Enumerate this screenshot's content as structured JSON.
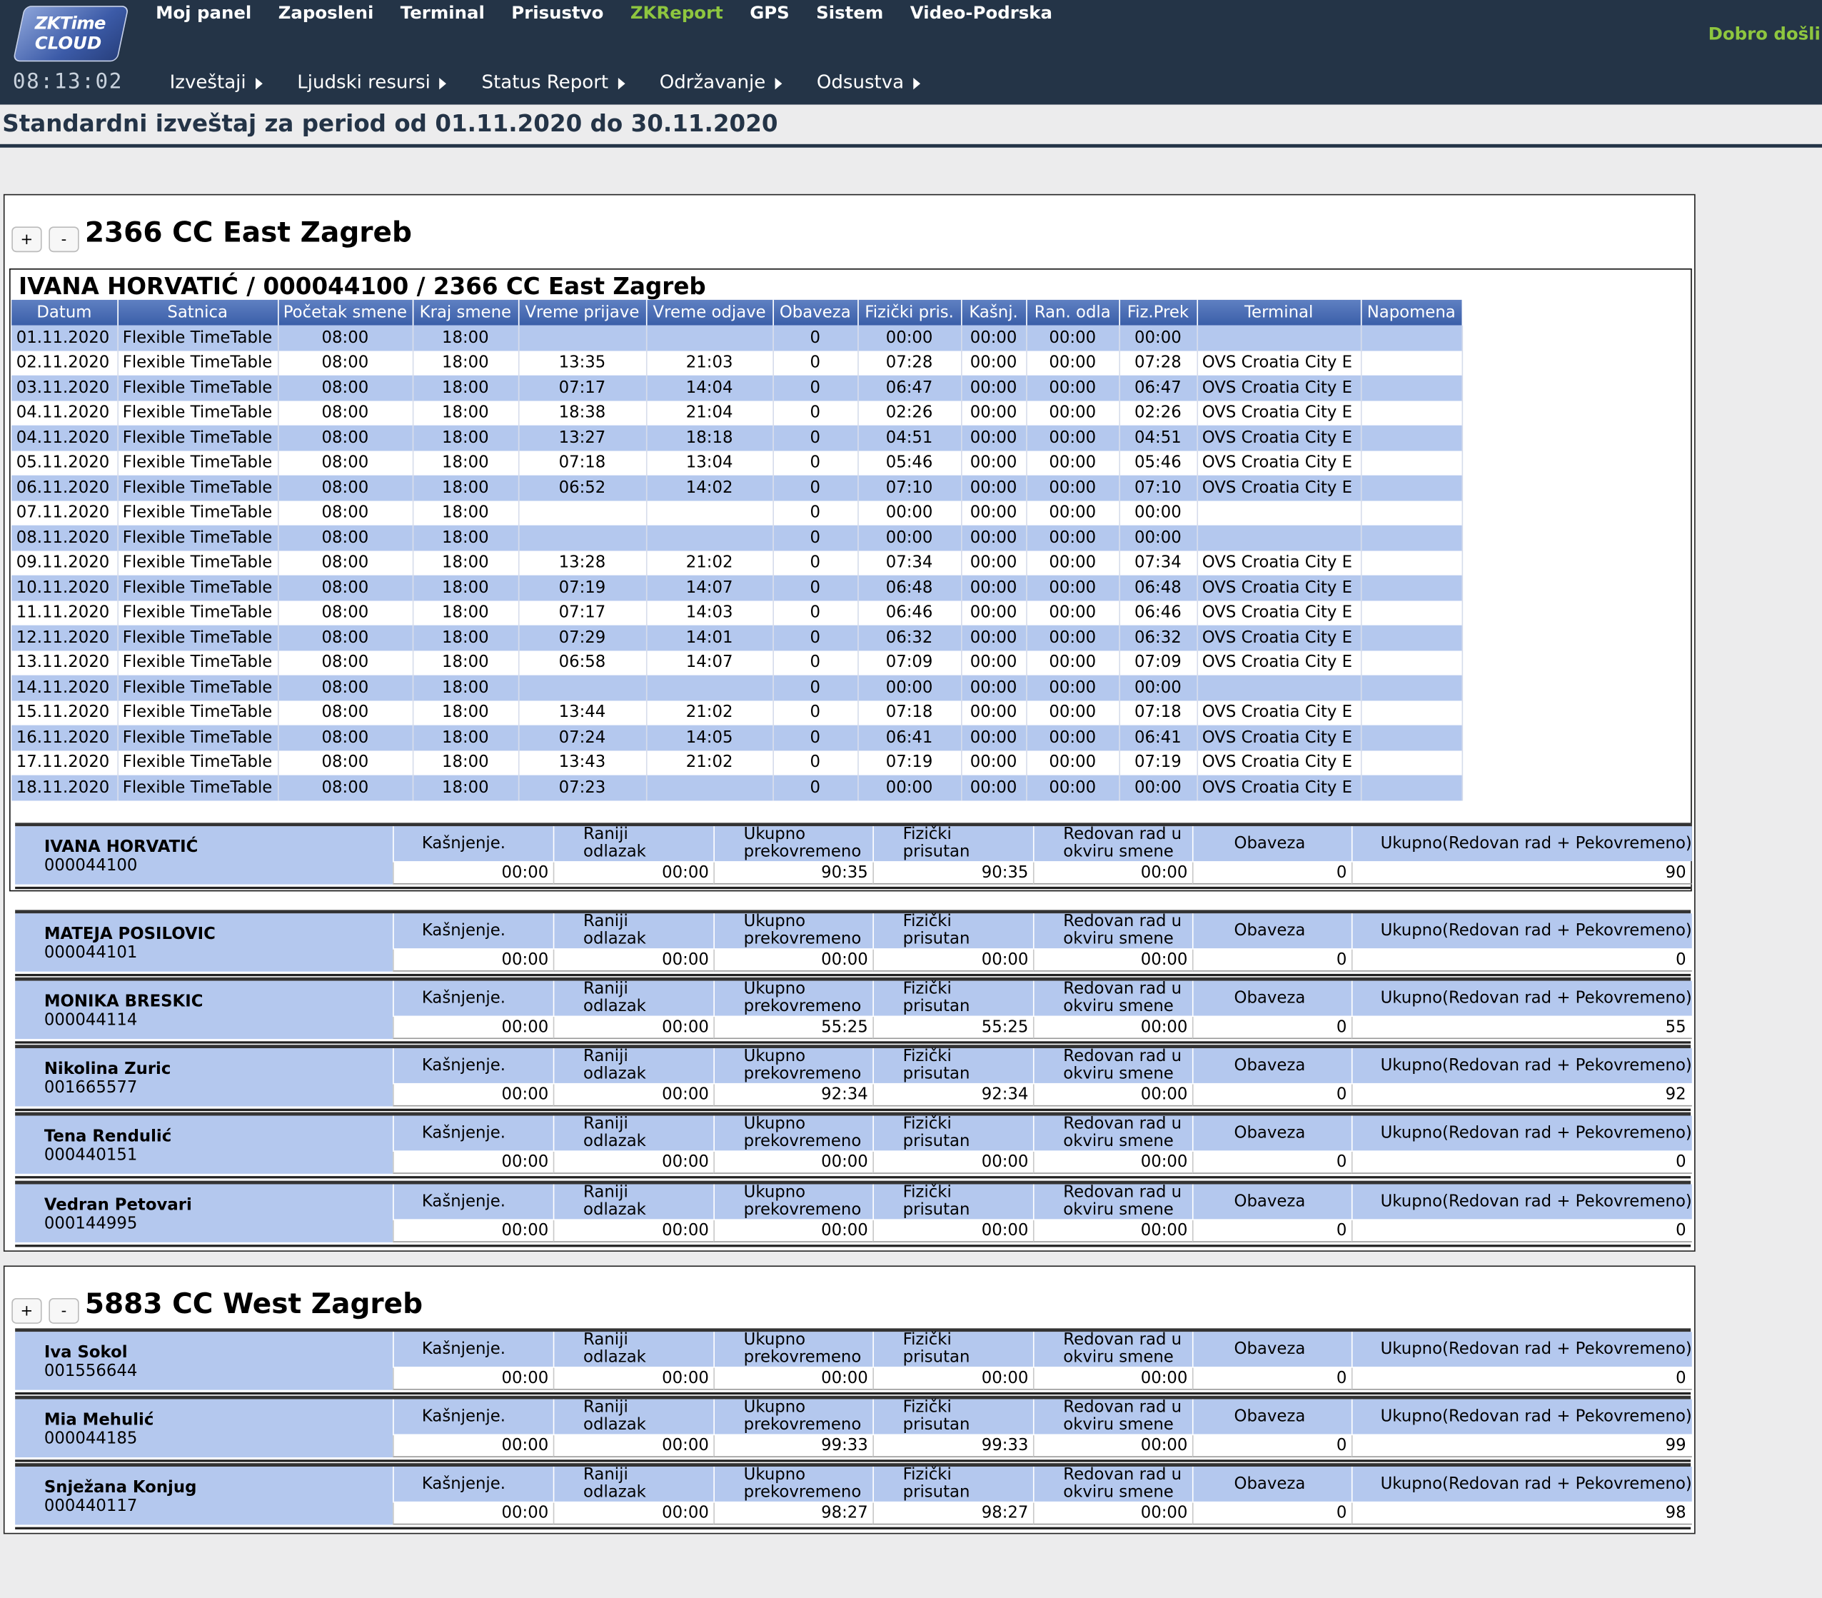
{
  "header": {
    "logo_line1": "ZKTime",
    "logo_line2": "CLOUD",
    "clock": "08:13:02",
    "nav": [
      "Moj panel",
      "Zaposleni",
      "Terminal",
      "Prisustvo",
      "ZKReport",
      "GPS",
      "Sistem",
      "Video-Podrska"
    ],
    "nav_active": "ZKReport",
    "welcome": "Dobro došli",
    "subnav": [
      "Izveštaji",
      "Ljudski resursi",
      "Status Report",
      "Održavanje",
      "Odsustva"
    ]
  },
  "page_title": "Standardni izveštaj za period od 01.11.2020 do 30.11.2020",
  "buttons": {
    "expand": "+",
    "collapse": "-"
  },
  "columns": [
    "Datum",
    "Satnica",
    "Početak smene",
    "Kraj smene",
    "Vreme prijave",
    "Vreme odjave",
    "Obaveza",
    "Fizički pris.",
    "Kašnj.",
    "Ran. odla",
    "Fiz.Prek",
    "Terminal",
    "Napomena"
  ],
  "summary_labels": {
    "late": "Kašnjenje.",
    "early_1": "Raniji",
    "early_2": "odlazak",
    "overtime_1": "Ukupno",
    "overtime_2": "prekovremeno",
    "present_1": "Fizički",
    "present_2": "prisutan",
    "regular_1": "Redovan rad u",
    "regular_2": "okviru smene",
    "obligation": "Obaveza",
    "total": "Ukupno(Redovan rad + Pekovremeno)"
  },
  "groups": [
    {
      "title": "2366 CC East Zagreb",
      "detail": {
        "heading": "IVANA HORVATIĆ / 000044100 / 2366 CC East Zagreb",
        "rows": [
          [
            "01.11.2020",
            "Flexible TimeTable",
            "08:00",
            "18:00",
            "",
            "",
            "0",
            "00:00",
            "00:00",
            "00:00",
            "00:00",
            "",
            ""
          ],
          [
            "02.11.2020",
            "Flexible TimeTable",
            "08:00",
            "18:00",
            "13:35",
            "21:03",
            "0",
            "07:28",
            "00:00",
            "00:00",
            "07:28",
            "OVS Croatia City E",
            ""
          ],
          [
            "03.11.2020",
            "Flexible TimeTable",
            "08:00",
            "18:00",
            "07:17",
            "14:04",
            "0",
            "06:47",
            "00:00",
            "00:00",
            "06:47",
            "OVS Croatia City E",
            ""
          ],
          [
            "04.11.2020",
            "Flexible TimeTable",
            "08:00",
            "18:00",
            "18:38",
            "21:04",
            "0",
            "02:26",
            "00:00",
            "00:00",
            "02:26",
            "OVS Croatia City E",
            ""
          ],
          [
            "04.11.2020",
            "Flexible TimeTable",
            "08:00",
            "18:00",
            "13:27",
            "18:18",
            "0",
            "04:51",
            "00:00",
            "00:00",
            "04:51",
            "OVS Croatia City E",
            ""
          ],
          [
            "05.11.2020",
            "Flexible TimeTable",
            "08:00",
            "18:00",
            "07:18",
            "13:04",
            "0",
            "05:46",
            "00:00",
            "00:00",
            "05:46",
            "OVS Croatia City E",
            ""
          ],
          [
            "06.11.2020",
            "Flexible TimeTable",
            "08:00",
            "18:00",
            "06:52",
            "14:02",
            "0",
            "07:10",
            "00:00",
            "00:00",
            "07:10",
            "OVS Croatia City E",
            ""
          ],
          [
            "07.11.2020",
            "Flexible TimeTable",
            "08:00",
            "18:00",
            "",
            "",
            "0",
            "00:00",
            "00:00",
            "00:00",
            "00:00",
            "",
            ""
          ],
          [
            "08.11.2020",
            "Flexible TimeTable",
            "08:00",
            "18:00",
            "",
            "",
            "0",
            "00:00",
            "00:00",
            "00:00",
            "00:00",
            "",
            ""
          ],
          [
            "09.11.2020",
            "Flexible TimeTable",
            "08:00",
            "18:00",
            "13:28",
            "21:02",
            "0",
            "07:34",
            "00:00",
            "00:00",
            "07:34",
            "OVS Croatia City E",
            ""
          ],
          [
            "10.11.2020",
            "Flexible TimeTable",
            "08:00",
            "18:00",
            "07:19",
            "14:07",
            "0",
            "06:48",
            "00:00",
            "00:00",
            "06:48",
            "OVS Croatia City E",
            ""
          ],
          [
            "11.11.2020",
            "Flexible TimeTable",
            "08:00",
            "18:00",
            "07:17",
            "14:03",
            "0",
            "06:46",
            "00:00",
            "00:00",
            "06:46",
            "OVS Croatia City E",
            ""
          ],
          [
            "12.11.2020",
            "Flexible TimeTable",
            "08:00",
            "18:00",
            "07:29",
            "14:01",
            "0",
            "06:32",
            "00:00",
            "00:00",
            "06:32",
            "OVS Croatia City E",
            ""
          ],
          [
            "13.11.2020",
            "Flexible TimeTable",
            "08:00",
            "18:00",
            "06:58",
            "14:07",
            "0",
            "07:09",
            "00:00",
            "00:00",
            "07:09",
            "OVS Croatia City E",
            ""
          ],
          [
            "14.11.2020",
            "Flexible TimeTable",
            "08:00",
            "18:00",
            "",
            "",
            "0",
            "00:00",
            "00:00",
            "00:00",
            "00:00",
            "",
            ""
          ],
          [
            "15.11.2020",
            "Flexible TimeTable",
            "08:00",
            "18:00",
            "13:44",
            "21:02",
            "0",
            "07:18",
            "00:00",
            "00:00",
            "07:18",
            "OVS Croatia City E",
            ""
          ],
          [
            "16.11.2020",
            "Flexible TimeTable",
            "08:00",
            "18:00",
            "07:24",
            "14:05",
            "0",
            "06:41",
            "00:00",
            "00:00",
            "06:41",
            "OVS Croatia City E",
            ""
          ],
          [
            "17.11.2020",
            "Flexible TimeTable",
            "08:00",
            "18:00",
            "13:43",
            "21:02",
            "0",
            "07:19",
            "00:00",
            "00:00",
            "07:19",
            "OVS Croatia City E",
            ""
          ],
          [
            "18.11.2020",
            "Flexible TimeTable",
            "08:00",
            "18:00",
            "07:23",
            "",
            "0",
            "00:00",
            "00:00",
            "00:00",
            "00:00",
            "OVS Croatia City E",
            ""
          ]
        ]
      },
      "employees": [
        {
          "name": "IVANA HORVATIĆ",
          "id": "000044100",
          "late": "00:00",
          "early": "00:00",
          "overtime": "90:35",
          "present": "90:35",
          "regular": "00:00",
          "obligation": "0",
          "total": "90"
        },
        {
          "name": "MATEJA POSILOVIC",
          "id": "000044101",
          "late": "00:00",
          "early": "00:00",
          "overtime": "00:00",
          "present": "00:00",
          "regular": "00:00",
          "obligation": "0",
          "total": "0"
        },
        {
          "name": "MONIKA BRESKIC",
          "id": "000044114",
          "late": "00:00",
          "early": "00:00",
          "overtime": "55:25",
          "present": "55:25",
          "regular": "00:00",
          "obligation": "0",
          "total": "55"
        },
        {
          "name": "Nikolina Zuric",
          "id": "001665577",
          "late": "00:00",
          "early": "00:00",
          "overtime": "92:34",
          "present": "92:34",
          "regular": "00:00",
          "obligation": "0",
          "total": "92"
        },
        {
          "name": "Tena Rendulić",
          "id": "000440151",
          "late": "00:00",
          "early": "00:00",
          "overtime": "00:00",
          "present": "00:00",
          "regular": "00:00",
          "obligation": "0",
          "total": "0"
        },
        {
          "name": "Vedran Petovari",
          "id": "000144995",
          "late": "00:00",
          "early": "00:00",
          "overtime": "00:00",
          "present": "00:00",
          "regular": "00:00",
          "obligation": "0",
          "total": "0"
        }
      ]
    },
    {
      "title": "5883 CC West Zagreb",
      "employees": [
        {
          "name": "Iva Sokol",
          "id": "001556644",
          "late": "00:00",
          "early": "00:00",
          "overtime": "00:00",
          "present": "00:00",
          "regular": "00:00",
          "obligation": "0",
          "total": "0"
        },
        {
          "name": "Mia Mehulić",
          "id": "000044185",
          "late": "00:00",
          "early": "00:00",
          "overtime": "99:33",
          "present": "99:33",
          "regular": "00:00",
          "obligation": "0",
          "total": "99"
        },
        {
          "name": "Snježana Konjug",
          "id": "000440117",
          "late": "00:00",
          "early": "00:00",
          "overtime": "98:27",
          "present": "98:27",
          "regular": "00:00",
          "obligation": "0",
          "total": "98"
        }
      ]
    }
  ]
}
